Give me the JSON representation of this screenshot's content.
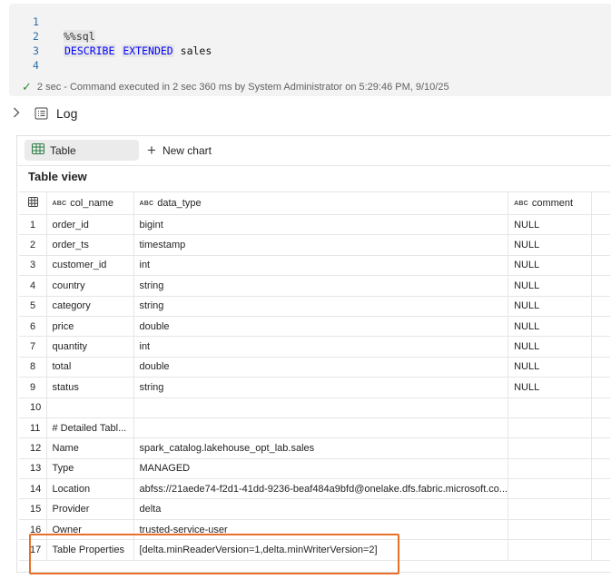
{
  "code": {
    "lines": [
      {
        "num": "1",
        "text": ""
      },
      {
        "num": "2",
        "magic": "%%sql"
      },
      {
        "num": "3",
        "kw1": "DESCRIBE",
        "kw2": "EXTENDED",
        "rest": "sales"
      },
      {
        "num": "4",
        "text": ""
      }
    ],
    "status": "2 sec - Command executed in 2 sec 360 ms by System Administrator on 5:29:46 PM, 9/10/25"
  },
  "log": {
    "label": "Log"
  },
  "result": {
    "tabs": {
      "table": "Table",
      "new_chart": "New chart"
    },
    "title": "Table view",
    "columns": [
      "col_name",
      "data_type",
      "comment"
    ],
    "rows": [
      [
        "1",
        "order_id",
        "bigint",
        "NULL"
      ],
      [
        "2",
        "order_ts",
        "timestamp",
        "NULL"
      ],
      [
        "3",
        "customer_id",
        "int",
        "NULL"
      ],
      [
        "4",
        "country",
        "string",
        "NULL"
      ],
      [
        "5",
        "category",
        "string",
        "NULL"
      ],
      [
        "6",
        "price",
        "double",
        "NULL"
      ],
      [
        "7",
        "quantity",
        "int",
        "NULL"
      ],
      [
        "8",
        "total",
        "double",
        "NULL"
      ],
      [
        "9",
        "status",
        "string",
        "NULL"
      ],
      [
        "10",
        "",
        "",
        ""
      ],
      [
        "11",
        "# Detailed Tabl...",
        "",
        ""
      ],
      [
        "12",
        "Name",
        "spark_catalog.lakehouse_opt_lab.sales",
        ""
      ],
      [
        "13",
        "Type",
        "MANAGED",
        ""
      ],
      [
        "14",
        "Location",
        "abfss://21aede74-f2d1-41dd-9236-beaf484a9bfd@onelake.dfs.fabric.microsoft.co...",
        ""
      ],
      [
        "15",
        "Provider",
        "delta",
        ""
      ],
      [
        "16",
        "Owner",
        "trusted-service-user",
        ""
      ],
      [
        "17",
        "Table Properties",
        "[delta.minReaderVersion=1,delta.minWriterVersion=2]",
        ""
      ]
    ]
  },
  "colors": {
    "accent_highlight": "#e8702a",
    "success": "#2e8b2e",
    "keyword": "#0000ff"
  }
}
